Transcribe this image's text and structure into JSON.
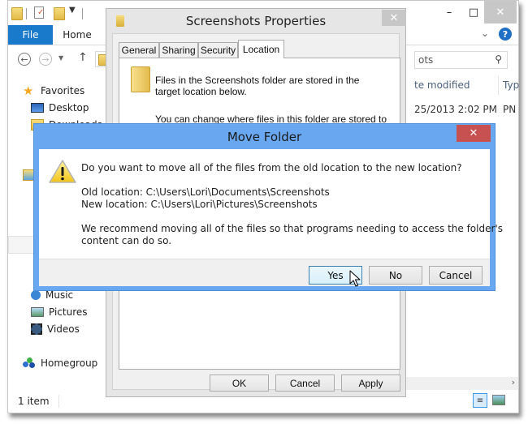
{
  "explorer": {
    "ribbon": {
      "file_tab": "File",
      "home_tab": "Home"
    },
    "window_controls": {
      "minimize": "–",
      "maximize": "□",
      "close": "✕"
    },
    "help": "?",
    "search": {
      "value": "ots",
      "icon": "search-icon"
    },
    "columns": {
      "date_modified": "te modified",
      "type": "Typ"
    },
    "file_row": {
      "date": "25/2013 2:02 PM",
      "type": "PN"
    },
    "nav_pane": {
      "favorites": "Favorites",
      "desktop": "Desktop",
      "downloads": "Downloads",
      "music": "Music",
      "pictures": "Pictures",
      "videos": "Videos",
      "homegroup": "Homegroup"
    },
    "status": {
      "items": "1 item"
    },
    "scroll_right": "›"
  },
  "properties": {
    "title": "Screenshots Properties",
    "close": "✕",
    "tabs": [
      {
        "label": "General",
        "active": false
      },
      {
        "label": "Sharing",
        "active": false
      },
      {
        "label": "Security",
        "active": false
      },
      {
        "label": "Location",
        "active": true
      }
    ],
    "description_line1": "Files in the Screenshots folder are stored in the",
    "description_line2": "target location below.",
    "change_text": "You can change where files in this folder are stored to",
    "buttons": {
      "ok": "OK",
      "cancel": "Cancel",
      "apply": "Apply"
    }
  },
  "move_folder": {
    "title": "Move Folder",
    "close": "✕",
    "question": "Do you want to move all of the files from the old location to the new location?",
    "old_location": "Old location: C:\\Users\\Lori\\Documents\\Screenshots",
    "new_location": "New location: C:\\Users\\Lori\\Pictures\\Screenshots",
    "recommend_line1": "We recommend moving all of the files so that programs needing to access the folder's",
    "recommend_line2": "content can do so.",
    "buttons": {
      "yes": "Yes",
      "no": "No",
      "cancel": "Cancel"
    },
    "focused_button": "Yes",
    "colors": {
      "frame": "#69a8f0",
      "close": "#c75050"
    }
  }
}
